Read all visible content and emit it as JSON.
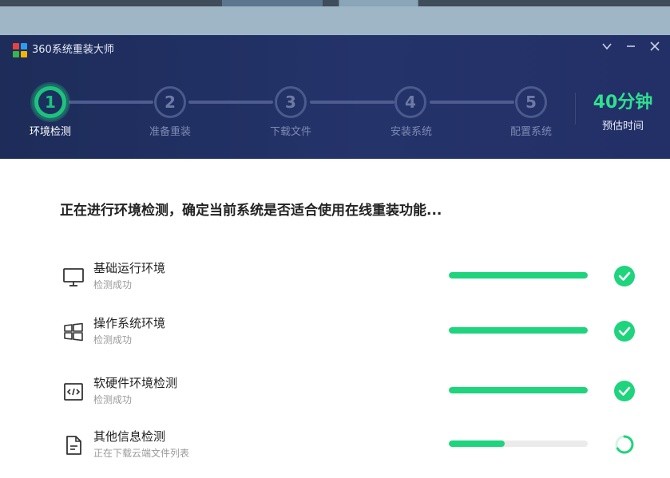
{
  "window": {
    "title": "360系统重装大师",
    "controls": {
      "dropdown_icon": "chevron-down-icon",
      "minimize_icon": "minimize-icon",
      "close_icon": "close-icon"
    }
  },
  "steps": [
    {
      "number": "1",
      "label": "环境检测",
      "active": true
    },
    {
      "number": "2",
      "label": "准备重装",
      "active": false
    },
    {
      "number": "3",
      "label": "下载文件",
      "active": false
    },
    {
      "number": "4",
      "label": "安装系统",
      "active": false
    },
    {
      "number": "5",
      "label": "配置系统",
      "active": false
    }
  ],
  "estimate": {
    "value": "40分钟",
    "label": "预估时间"
  },
  "main": {
    "headline": "正在进行环境检测，确定当前系统是否适合使用在线重装功能...",
    "checks": [
      {
        "name": "基础运行环境",
        "status": "检测成功",
        "progress": 1.0,
        "done": true,
        "icon": "monitor-icon"
      },
      {
        "name": "操作系统环境",
        "status": "检测成功",
        "progress": 1.0,
        "done": true,
        "icon": "windows-logo-icon"
      },
      {
        "name": "软硬件环境检测",
        "status": "检测成功",
        "progress": 1.0,
        "done": true,
        "icon": "code-window-icon"
      },
      {
        "name": "其他信息检测",
        "status": "正在下载云端文件列表",
        "progress": 0.4,
        "done": false,
        "icon": "document-icon"
      }
    ]
  },
  "colors": {
    "header_bg": "#1d2c59",
    "accent_green": "#1ed47d",
    "estimate_green": "#2fe08f",
    "inactive_step": "#4b5a8d"
  }
}
